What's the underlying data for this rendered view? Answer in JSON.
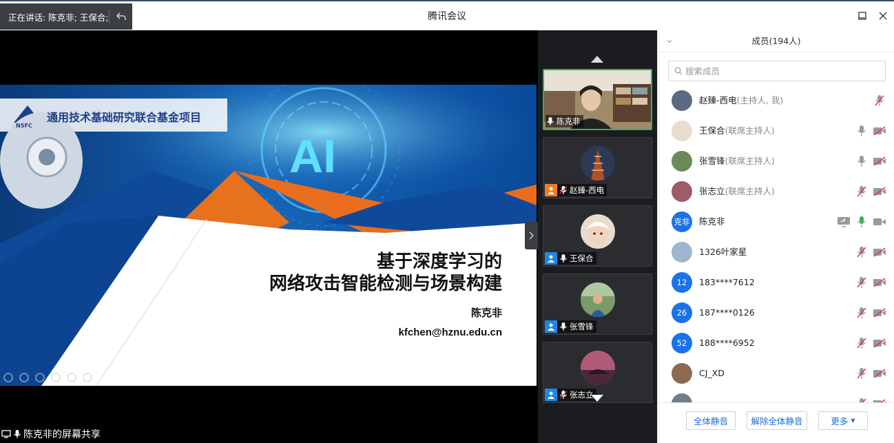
{
  "window": {
    "title": "腾讯会议"
  },
  "speaking": {
    "label": "正在讲话: 陈克非; 王保合;"
  },
  "share": {
    "label": "陈克非的屏幕共享"
  },
  "slide": {
    "org": "通用技术基础研究联合基金项目",
    "logo_text": "NSFC",
    "ai_text": "AI",
    "title_line1": "基于深度学习的",
    "title_line2": "网络攻击智能检测与场景构建",
    "author": "陈克非",
    "email": "kfchen@hznu.edu.cn"
  },
  "videos": [
    {
      "name": "陈克非",
      "active": true
    },
    {
      "name": "赵臻-西电",
      "host": true
    },
    {
      "name": "王保合"
    },
    {
      "name": "张雪锋"
    },
    {
      "name": "张志立"
    }
  ],
  "panel": {
    "title": "成员(194人)",
    "search_placeholder": "搜索成员"
  },
  "members": [
    {
      "name": "赵臻-西电",
      "role": "(主持人, 我)",
      "avatar_text": "",
      "avatar_color": "#5b6a80",
      "icons": [
        "mic-muted"
      ]
    },
    {
      "name": "王保合",
      "role": "(联席主持人)",
      "avatar_text": "",
      "avatar_color": "#e9dccd",
      "icons": [
        "mic",
        "cam-off"
      ]
    },
    {
      "name": "张雪锋",
      "role": "(联席主持人)",
      "avatar_text": "",
      "avatar_color": "#6b8a5c",
      "icons": [
        "mic",
        "cam-off"
      ]
    },
    {
      "name": "张志立",
      "role": "(联席主持人)",
      "avatar_text": "",
      "avatar_color": "#a05a6a",
      "icons": [
        "mic-muted",
        "cam-off"
      ]
    },
    {
      "name": "陈克非",
      "role": "",
      "avatar_text": "克非",
      "avatar_color": "#1a73e8",
      "icons": [
        "screen-share",
        "mic-active",
        "cam"
      ]
    },
    {
      "name": "1326叶家星",
      "role": "",
      "avatar_text": "",
      "avatar_color": "#9fb6cc",
      "icons": [
        "mic-muted",
        "cam-off"
      ]
    },
    {
      "name": "183****7612",
      "role": "",
      "avatar_text": "12",
      "avatar_color": "#1a73e8",
      "icons": [
        "mic-muted",
        "cam-off"
      ]
    },
    {
      "name": "187****0126",
      "role": "",
      "avatar_text": "26",
      "avatar_color": "#1a73e8",
      "icons": [
        "mic-muted",
        "cam-off"
      ]
    },
    {
      "name": "188****6952",
      "role": "",
      "avatar_text": "52",
      "avatar_color": "#1a73e8",
      "icons": [
        "mic-muted",
        "cam-off"
      ]
    },
    {
      "name": "CJ_XD",
      "role": "",
      "avatar_text": "",
      "avatar_color": "#8a6a50",
      "icons": [
        "mic-muted",
        "cam-off"
      ]
    },
    {
      "name": "",
      "role": "",
      "avatar_text": "",
      "avatar_color": "#70808a",
      "icons": [
        "mic-muted",
        "cam-off"
      ]
    }
  ],
  "footer": {
    "mute_all": "全体静音",
    "unmute_all": "解除全体静音",
    "more": "更多"
  }
}
